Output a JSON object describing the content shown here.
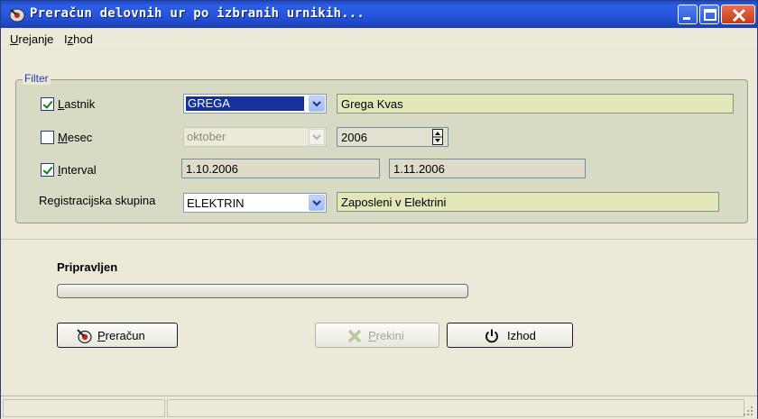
{
  "window": {
    "title": "Preračun delovnih ur po izbranih urnikih...",
    "title_color": "#2453d8",
    "close_color": "#c23a1e"
  },
  "menu": {
    "items": [
      {
        "label_u": "U",
        "label_rest": "rejanje"
      },
      {
        "label_pre": "I",
        "label_u": "z",
        "label_rest": "hod"
      }
    ]
  },
  "filter": {
    "legend": "Filter",
    "lastnik": {
      "checked": true,
      "label_u": "L",
      "label_rest": "astnik",
      "combo_value": "GREGA",
      "name": "Grega Kvas"
    },
    "mesec": {
      "checked": false,
      "label_u": "M",
      "label_rest": "esec",
      "combo_value": "oktober",
      "year": "2006"
    },
    "interval": {
      "checked": true,
      "label_u": "I",
      "label_rest": "nterval",
      "from": "1.10.2006",
      "to": "1.11.2006"
    },
    "skupina": {
      "label": "Registracijska skupina",
      "combo_value": "ELEKTRIN",
      "description": "Zaposleni v Elektrini"
    }
  },
  "status": {
    "text": "Pripravljen",
    "progress": 0
  },
  "buttons": {
    "preracun": {
      "label_u": "P",
      "label_rest": "reračun",
      "icon": "calculate-icon"
    },
    "prekini": {
      "label_u": "P",
      "label_rest": "rekini",
      "icon": "cancel-icon",
      "enabled": false
    },
    "izhod": {
      "label": "Izhod",
      "icon": "power-icon"
    }
  }
}
